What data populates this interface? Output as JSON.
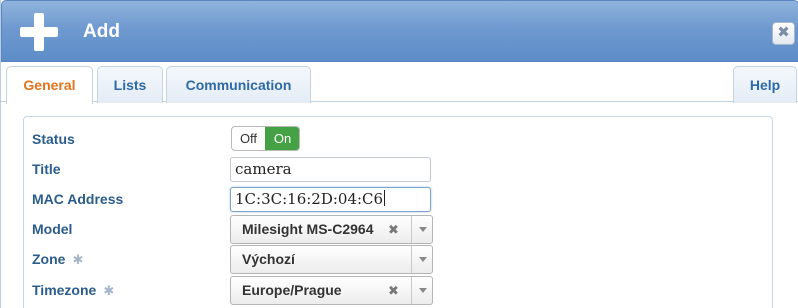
{
  "dialog": {
    "title": "Add",
    "close_icon": "close-icon",
    "add_icon": "plus-icon"
  },
  "tabs": [
    {
      "label": "General",
      "active": true
    },
    {
      "label": "Lists",
      "active": false
    },
    {
      "label": "Communication",
      "active": false
    },
    {
      "label": "Help",
      "active": false
    }
  ],
  "form": {
    "status": {
      "label": "Status",
      "off_label": "Off",
      "on_label": "On",
      "value": "On"
    },
    "title": {
      "label": "Title",
      "value": "camera"
    },
    "mac": {
      "label": "MAC Address",
      "value": "1C:3C:16:2D:04:C6"
    },
    "model": {
      "label": "Model",
      "value": "Milesight MS-C2964",
      "clear": "✖"
    },
    "zone": {
      "label": "Zone",
      "value": "Výchozí",
      "required_icon": "✱"
    },
    "timezone": {
      "label": "Timezone",
      "value": "Europe/Prague",
      "clear": "✖",
      "required_icon": "✱"
    }
  },
  "colors": {
    "accent_tab": "#e2731a",
    "toggle_on": "#45a244",
    "label": "#2b5d8c"
  }
}
